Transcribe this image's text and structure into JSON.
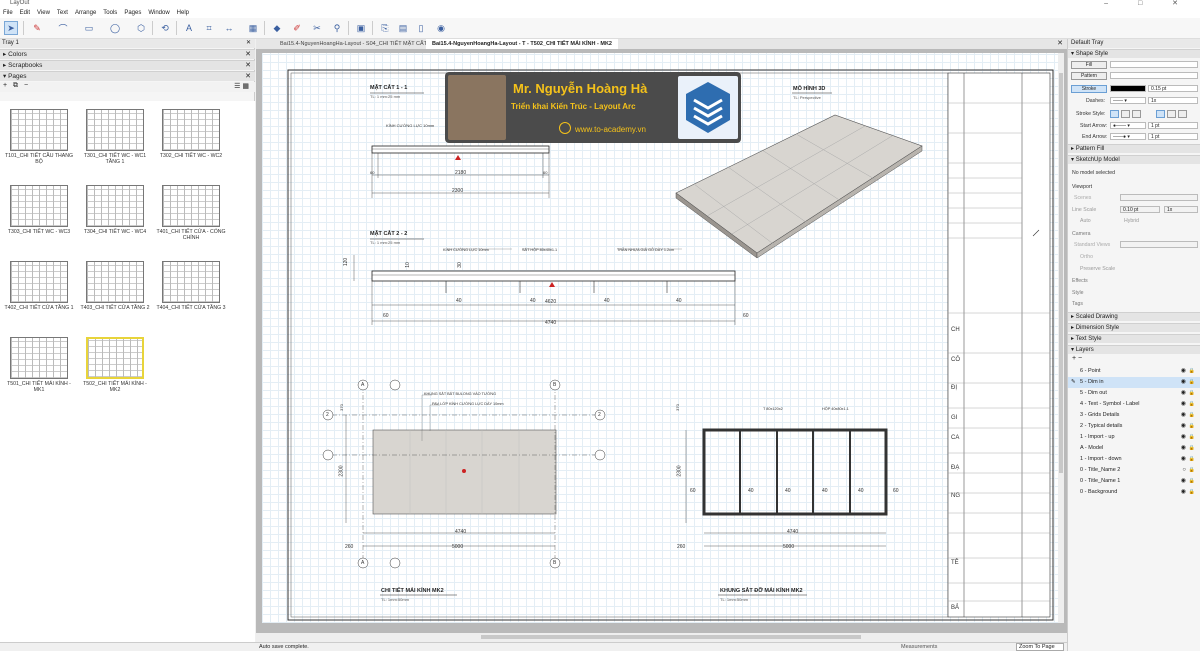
{
  "app": {
    "title": "LayOut"
  },
  "menu": [
    "File",
    "Edit",
    "View",
    "Text",
    "Arrange",
    "Tools",
    "Pages",
    "Window",
    "Help"
  ],
  "left_tray": {
    "title": "Tray 1",
    "panels": {
      "colors": "Colors",
      "scrapbooks": "Scrapbooks",
      "pages": "Pages"
    },
    "pages": [
      {
        "label": "T101_CHI TIẾT CẦU THANG BỘ"
      },
      {
        "label": "T301_CHI TIẾT WC - WC1 TẦNG 1"
      },
      {
        "label": "T302_CHI TIẾT WC - WC2"
      },
      {
        "label": "T303_CHI TIẾT WC - WC3"
      },
      {
        "label": "T304_CHI TIẾT WC - WC4"
      },
      {
        "label": "T401_CHI TIẾT CỬA - CỔNG CHÍNH"
      },
      {
        "label": "T402_CHI TIẾT CỬA TẦNG 1"
      },
      {
        "label": "T403_CHI TIẾT CỬA TẦNG 2"
      },
      {
        "label": "T404_CHI TIẾT CỬA TẦNG 3"
      },
      {
        "label": "T501_CHI TIẾT MÁI KÍNH - MK1"
      },
      {
        "label": "T502_CHI TIẾT MÁI KÍNH - MK2"
      }
    ]
  },
  "doc_tabs": [
    "Bai15.4-NguyenHoangHa-Layout - S04_CHI TIẾT MẶT CẮT",
    "Bai15.4-NguyenHoangHa-Layout - T - T502_CHI TIẾT MÁI KÍNH - MK2"
  ],
  "status": {
    "message": "Auto save complete.",
    "measurements": "Measurements",
    "zoom": "Zoom To Page"
  },
  "right_tray": {
    "title": "Default Tray",
    "shape_style": "Shape Style",
    "fill": "Fill",
    "pattern": "Pattern",
    "stroke": "Stroke",
    "stroke_width": "0.15 pt",
    "dashes": "Dashes:",
    "dash_scale": "1x",
    "stroke_style": "Stroke Style:",
    "start_arrow": "Start Arrow:",
    "end_arrow": "End Arrow:",
    "arrow_size": "1 pt",
    "pattern_fill": "Pattern Fill",
    "sketchup_model": "SketchUp Model",
    "no_model": "No model selected",
    "viewport": "Viewport",
    "scenes": "Scenes",
    "line_scale": "Line Scale",
    "line_scale_val": "0.10 pt",
    "line_scale_mult": "1x",
    "auto": "Auto",
    "hybrid": "Hybrid",
    "camera": "Camera",
    "standard_views": "Standard Views",
    "ortho": "Ortho",
    "preserve_scale": "Preserve Scale",
    "effects": "Effects",
    "style": "Style",
    "tags": "Tags",
    "scaled_drawing": "Scaled Drawing",
    "dimension_style": "Dimension Style",
    "text_style": "Text Style",
    "layers_title": "Layers",
    "layers": [
      {
        "name": "6 - Point"
      },
      {
        "name": "5 - Dim in"
      },
      {
        "name": "5 - Dim out"
      },
      {
        "name": "4 - Text - Symbol - Label"
      },
      {
        "name": "3 - Grids Details"
      },
      {
        "name": "2 - Typical details"
      },
      {
        "name": "1 - Import - up"
      },
      {
        "name": "A - Model"
      },
      {
        "name": "1 - Import - down"
      },
      {
        "name": "0 - Title_Name 2"
      },
      {
        "name": "0 - Title_Name 1"
      },
      {
        "name": "0 - Background"
      }
    ]
  },
  "drawing": {
    "sec1_title": "MẶT CẮT 1 - 1",
    "sec1_scale": "TL: 1 mm:25 mm",
    "sec1_note": "KÍNH CƯỜNG LỰC 10mm",
    "sec1_dims": [
      "2180",
      "2300",
      "60",
      "60"
    ],
    "sec2_title": "MẶT CẮT 2 - 2",
    "sec2_scale": "TL: 1 mm:25 mm",
    "sec2_notes": [
      "KÍNH CƯỜNG LỰC 10mm",
      "SẮT HỘP 80x40x1.1",
      "TRẦN NHỰA GIẢ GỖ DÀY 1.2cm"
    ],
    "sec2_dims": [
      "4620",
      "4740",
      "40",
      "60",
      "120",
      "10",
      "30"
    ],
    "model_title": "MÔ HÌNH 3D",
    "model_sub": "TL: Perspective",
    "plan_title": "CHI TIẾT MÁI KÍNH MK2",
    "plan_scale": "TL: 1mm:50mm",
    "plan_notes": [
      "KHUNG SẮT BẮT BULONG VÀO TƯỜNG",
      "PAV LỚP KÍNH CƯỜNG LỰC DÀY 10mm"
    ],
    "plan_dims": [
      "4740",
      "5000",
      "2300",
      "260",
      "370"
    ],
    "frame_title": "KHUNG SẮT ĐỠ MÁI KÍNH MK2",
    "frame_scale": "TL: 1mm:50mm",
    "frame_notes": [
      "T 80x120x2",
      "HỘP 40x80x1.1"
    ],
    "frame_dims": [
      "4740",
      "5000",
      "2300",
      "260",
      "370",
      "60",
      "40"
    ],
    "grid_labels": [
      "A",
      "B",
      "2"
    ],
    "banner": {
      "name": "Mr. Nguyễn Hoàng Hà",
      "subtitle": "Triển khai Kiến Trúc - Layout Arc",
      "web": "www.to-academy.vn"
    },
    "titleblock_text": [
      "CH",
      "CÔ",
      "ĐỊ",
      "GI",
      "CA",
      "ĐẠ",
      "NG",
      "TÊ",
      "BẢ"
    ]
  }
}
